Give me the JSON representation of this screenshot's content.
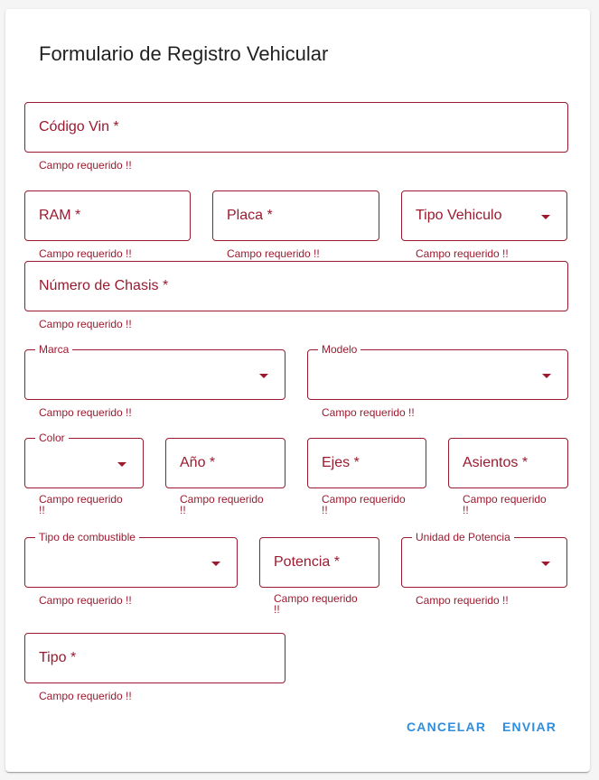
{
  "form": {
    "title": "Formulario de Registro Vehicular"
  },
  "fields": {
    "vin": {
      "label": "Código Vin *",
      "error": "Campo requerido !!"
    },
    "ram": {
      "label": "RAM *",
      "error": "Campo requerido !!"
    },
    "placa": {
      "label": "Placa *",
      "error": "Campo requerido !!"
    },
    "tipo_vehiculo": {
      "label": "Tipo Vehiculo",
      "error": "Campo requerido !!"
    },
    "chasis": {
      "label": "Número de Chasis *",
      "error": "Campo requerido !!"
    },
    "marca": {
      "label": "Marca",
      "error": "Campo requerido !!"
    },
    "modelo": {
      "label": "Modelo",
      "error": "Campo requerido !!"
    },
    "color": {
      "label": "Color",
      "error_1": "Campo requerido",
      "error_2": "!!"
    },
    "anio": {
      "label": "Año *",
      "error_1": "Campo requerido",
      "error_2": "!!"
    },
    "ejes": {
      "label": "Ejes *",
      "error_1": "Campo requerido",
      "error_2": "!!"
    },
    "asientos": {
      "label": "Asientos *",
      "error_1": "Campo requerido",
      "error_2": "!!"
    },
    "combustible": {
      "label": "Tipo de combustible",
      "error": "Campo requerido !!"
    },
    "potencia": {
      "label": "Potencia *",
      "error_1": "Campo requerido",
      "error_2": "!!"
    },
    "unidad_potencia": {
      "label": "Unidad de Potencia",
      "error": "Campo requerido !!"
    },
    "tipo": {
      "label": "Tipo *",
      "error": "Campo requerido !!"
    }
  },
  "actions": {
    "cancel_label": "CANCELAR",
    "submit_label": "ENVIAR"
  },
  "colors": {
    "error": "#9a1b2f",
    "action": "#2f8ee0"
  }
}
